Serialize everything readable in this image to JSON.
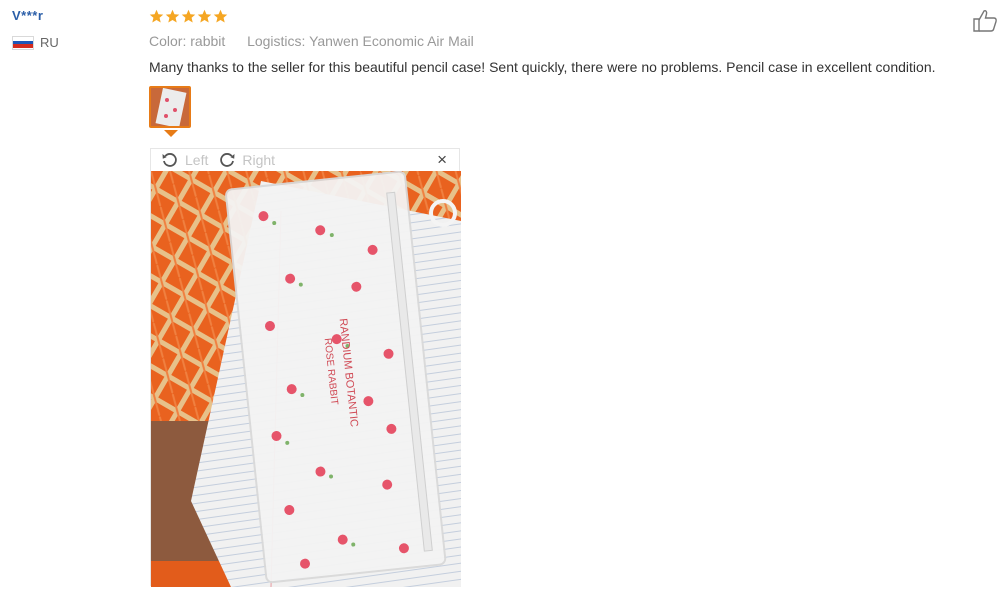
{
  "reviewer": {
    "name": "V***r",
    "country": "RU",
    "flag_icon": "russia-flag-icon"
  },
  "rating": {
    "stars": 5,
    "max": 5,
    "color": "#f5a623"
  },
  "meta": {
    "color_label": "Color:",
    "color_value": "rabbit",
    "logistics_label": "Logistics:",
    "logistics_value": "Yanwen Economic Air Mail"
  },
  "review_text": "Many thanks to the seller for this beautiful pencil case! Sent quickly, there were no problems. Pencil case in excellent condition.",
  "viewer": {
    "rotate_left": "Left",
    "rotate_right": "Right",
    "close": "×"
  },
  "photo": {
    "case_text_1": "RANDIUM BOTANTIC",
    "case_text_2": "ROSE RABBIT"
  },
  "colors": {
    "accent": "#e77b17",
    "link": "#2a5ea8"
  }
}
